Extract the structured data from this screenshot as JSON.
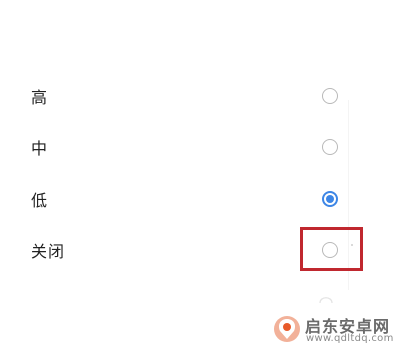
{
  "options": [
    {
      "label": "高",
      "selected": false
    },
    {
      "label": "中",
      "selected": false
    },
    {
      "label": "低",
      "selected": true
    },
    {
      "label": "关闭",
      "selected": false
    }
  ],
  "accent_color": "#3d86e6",
  "highlight_color": "#c0282f",
  "watermark": {
    "title": "启东安卓网",
    "url": "www.qdltdq.com",
    "icon": "watermark-logo-icon"
  }
}
